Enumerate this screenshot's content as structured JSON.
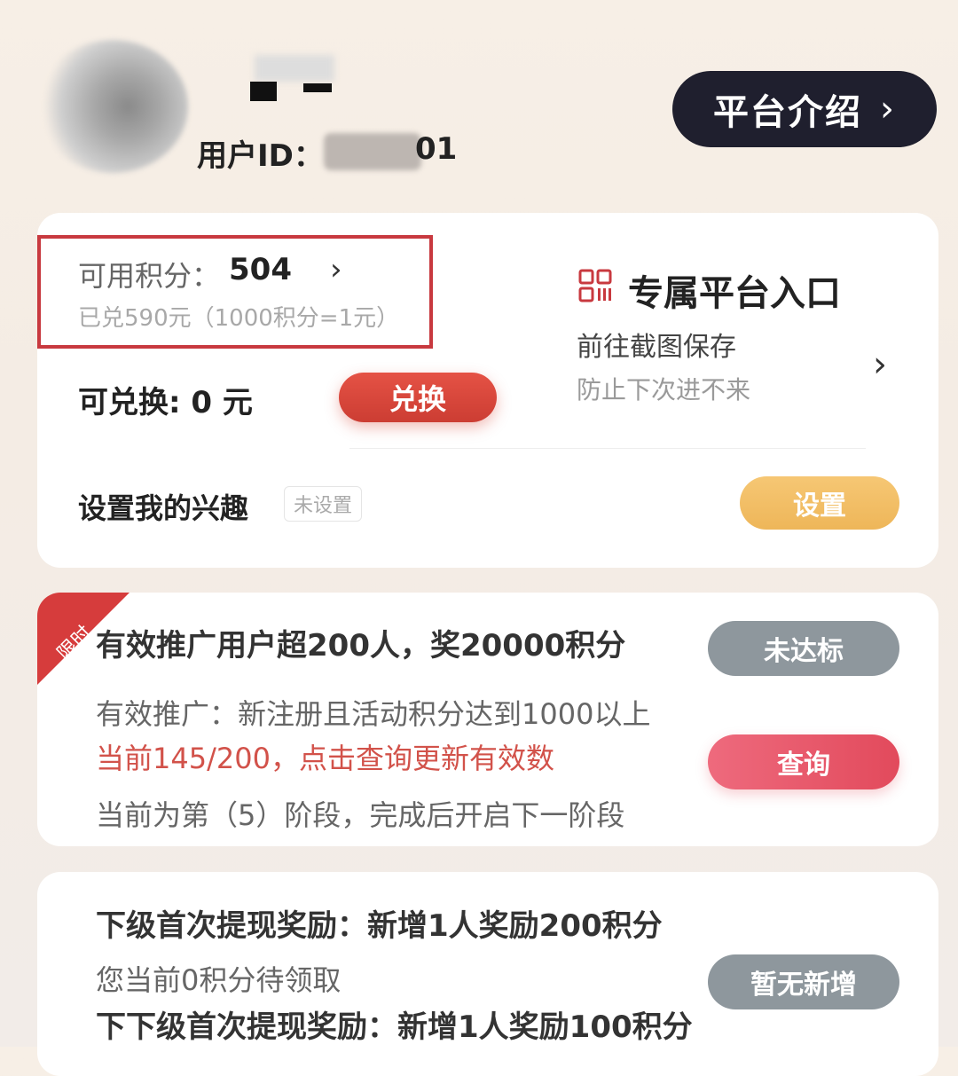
{
  "header": {
    "user_id_label": "用户ID：",
    "user_id_suffix": "01",
    "intro_button": "平台介绍",
    "chevron": "›"
  },
  "points": {
    "label": "可用积分：",
    "value": "504",
    "chevron": "›",
    "redeemed_note": "已兑590元（1000积分=1元）",
    "exchangeable_label": "可兑换: 0 元",
    "exchange_button": "兑换"
  },
  "platform_entry": {
    "icon": "qr-code-icon",
    "title": "专属平台入口",
    "subtitle": "前往截图保存",
    "note": "防止下次进不来",
    "chevron": "›"
  },
  "interest": {
    "label": "设置我的兴趣",
    "status_badge": "未设置",
    "set_button": "设置"
  },
  "promotion": {
    "ribbon": "限时",
    "title": "有效推广用户超200人，奖20000积分",
    "status_button": "未达标",
    "desc": "有效推广：新注册且活动积分达到1000以上",
    "current": "当前145/200，点击查询更新有效数",
    "query_button": "查询",
    "stage": "当前为第（5）阶段，完成后开启下一阶段"
  },
  "withdraw": {
    "title": "下级首次提现奖励：新增1人奖励200积分",
    "pending": "您当前0积分待领取",
    "sub_title": "下下级首次提现奖励：新增1人奖励100积分",
    "status_button": "暂无新增"
  },
  "colors": {
    "accent_red": "#d2524a",
    "dark_button": "#1f1f2e",
    "gold": "#f0b95c",
    "gray_button": "#8e979d"
  }
}
